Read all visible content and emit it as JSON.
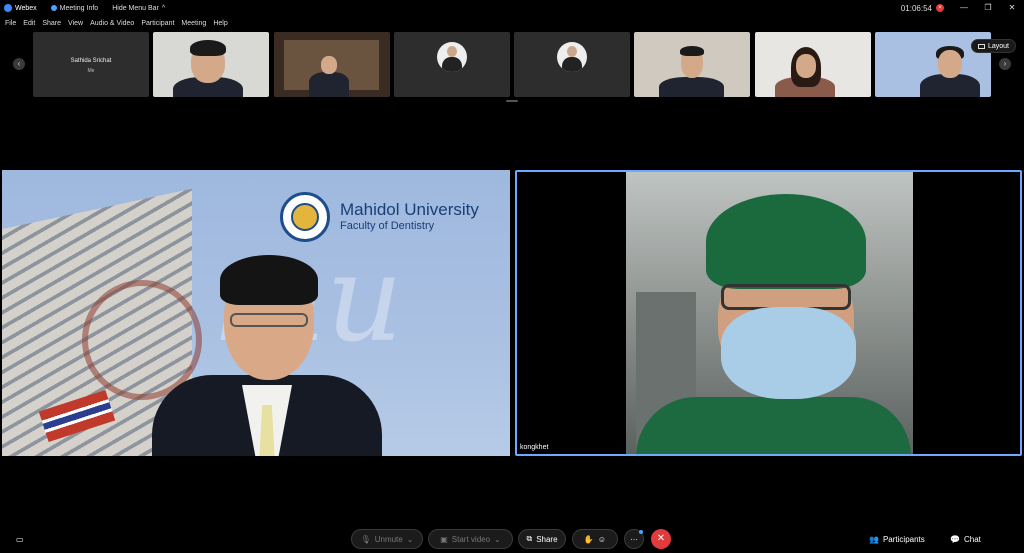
{
  "titlebar": {
    "app_name": "Webex",
    "meeting_info": "Meeting Info",
    "hide_menu_bar": "Hide Menu Bar",
    "timer": "01:06:54",
    "minimize": "—",
    "restore": "❐",
    "close": "✕",
    "chevron": "^"
  },
  "menubar": {
    "items": [
      "File",
      "Edit",
      "Share",
      "View",
      "Audio & Video",
      "Participant",
      "Meeting",
      "Help"
    ]
  },
  "strip": {
    "prev": "‹",
    "next": "›",
    "tiles": [
      {
        "name": "Sathida Srichat",
        "sub": "Me"
      }
    ],
    "layout_label": "Layout"
  },
  "main": {
    "left_pane": {
      "university": "Mahidol University",
      "faculty": "Faculty of Dentistry",
      "watermark": "mu"
    },
    "right_pane": {
      "participant_name": "kongkhet"
    }
  },
  "toolbar": {
    "unmute": "Unmute",
    "start_video": "Start video",
    "share": "Share",
    "more": "···",
    "participants": "Participants",
    "chat": "Chat",
    "leave": "✕",
    "caret": "⌄"
  },
  "colors": {
    "accent": "#6ea8ff",
    "leave": "#e23b3b",
    "scrubs": "#1e6a40"
  }
}
